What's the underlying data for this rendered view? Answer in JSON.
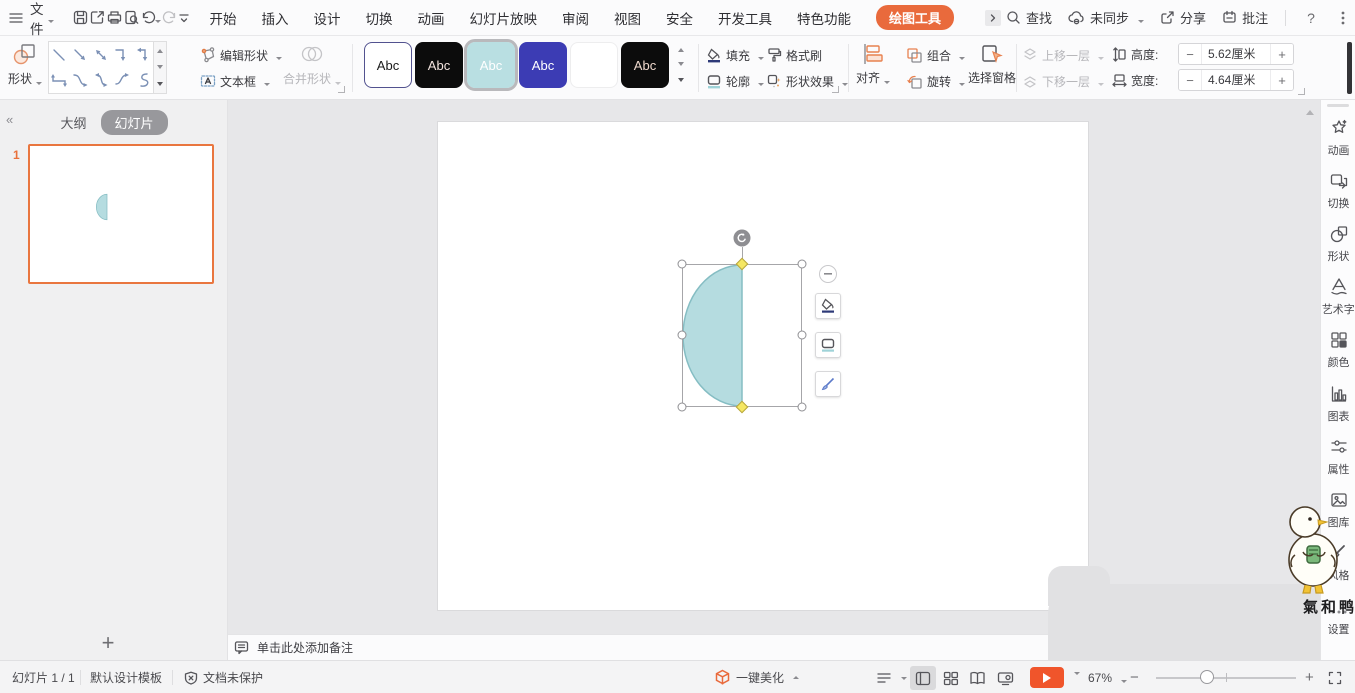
{
  "colors": {
    "accent": "#e96a3c",
    "shape_fill": "#b5dce0",
    "shape_stroke": "#85bdc3",
    "selected_style_ring": "#b9b9bc",
    "canvas_bg": "#e7e7e9"
  },
  "menubar": {
    "file_label": "文件",
    "quick_icons": [
      "save-icon",
      "export-icon",
      "print-icon",
      "print-preview-icon",
      "undo-icon",
      "redo-icon",
      "more-commands-icon"
    ],
    "tabs": [
      "开始",
      "插入",
      "设计",
      "切换",
      "动画",
      "幻灯片放映",
      "审阅",
      "视图",
      "安全",
      "开发工具",
      "特色功能"
    ],
    "active_tab": "绘图工具",
    "search_label": "查找",
    "sync_label": "未同步",
    "share_label": "分享",
    "comment_label": "批注",
    "help_glyph": "?"
  },
  "ribbon": {
    "shapes_label": "形状",
    "shape_gallery_icons": [
      "diagonal-line",
      "diagonal-arrow",
      "diagonal-double-arrow",
      "elbow-connector",
      "elbow-arrow-connector",
      "elbow-double-arrow-connector",
      "curved-connector",
      "curved-arrow-connector",
      "curved-double-arrow-connector",
      "freeform-s-curve"
    ],
    "edit_shape_label": "编辑形状",
    "textbox_label": "文本框",
    "merge_shapes_label": "合并形状",
    "style_gallery": [
      {
        "label": "Abc",
        "bg": "#ffffff",
        "border": "#52528f",
        "text": "#1a1a1a"
      },
      {
        "label": "Abc",
        "bg": "#0c0c0c",
        "border": "#0c0c0c",
        "text": "#f3e4df"
      },
      {
        "label": "Abc",
        "bg": "#b9dfe2",
        "border": "#b9dfe2",
        "text": "#ffffff"
      },
      {
        "label": "Abc",
        "bg": "#3c3cb4",
        "border": "#3c3cb4",
        "text": "#ffffff"
      },
      {
        "label": "",
        "bg": "#ffffff",
        "border": "#ededee",
        "text": "#ffffff"
      },
      {
        "label": "Abc",
        "bg": "#0c0c0c",
        "border": "#0c0c0c",
        "text": "#eed8cc"
      }
    ],
    "fill_label": "填充",
    "format_painter_label": "格式刷",
    "outline_label": "轮廓",
    "shape_effects_label": "形状效果",
    "align_label": "对齐",
    "group_label": "组合",
    "rotate_label": "旋转",
    "selection_pane_label": "选择窗格",
    "bring_forward_label": "上移一层",
    "send_backward_label": "下移一层",
    "height_label": "高度:",
    "height_value": "5.62厘米",
    "width_label": "宽度:",
    "width_value": "4.64厘米",
    "minus_glyph": "−",
    "plus_glyph": "+"
  },
  "left_panel": {
    "collapse_glyph": "«",
    "tab_outline": "大纲",
    "tab_slides": "幻灯片",
    "slide_number": "1",
    "add_slide_glyph": "+"
  },
  "canvas": {
    "selected_shape": "chord-half-circle",
    "floating_toolbar_icons": [
      "collapse-minus-icon",
      "fill-color-icon",
      "outline-color-icon",
      "brush-style-icon"
    ]
  },
  "right_sidebar": {
    "items": [
      {
        "label": "动画",
        "icon": "animation-icon"
      },
      {
        "label": "切换",
        "icon": "transition-icon"
      },
      {
        "label": "形状",
        "icon": "shape-icon"
      },
      {
        "label": "艺术字",
        "icon": "wordart-icon"
      },
      {
        "label": "颜色",
        "icon": "color-scheme-icon"
      },
      {
        "label": "图表",
        "icon": "chart-icon"
      },
      {
        "label": "属性",
        "icon": "properties-icon"
      },
      {
        "label": "图库",
        "icon": "image-library-icon"
      },
      {
        "label": "风格",
        "icon": "style-icon"
      },
      {
        "label": "设置",
        "icon": "settings-icon"
      }
    ],
    "mascot": "duck-mascot",
    "mascot_caption": "氣和鸭"
  },
  "notes_bar": {
    "placeholder": "单击此处添加备注"
  },
  "statusbar": {
    "slide_counter": "幻灯片 1 / 1",
    "template_name": "默认设计模板",
    "protection_label": "文档未保护",
    "beautify_label": "一键美化",
    "view_icons": [
      "notes-toggle-icon",
      "normal-view-icon",
      "slide-sorter-icon",
      "reading-view-icon",
      "projector-view-icon"
    ],
    "zoom_value": "67%",
    "zoom_out_glyph": "−",
    "zoom_in_glyph": "+"
  }
}
